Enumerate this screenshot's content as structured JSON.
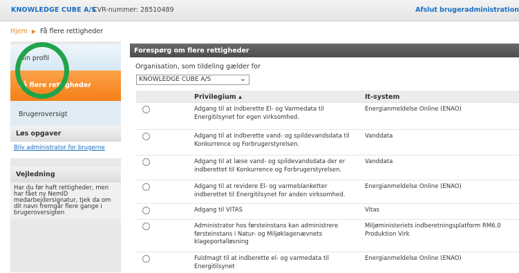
{
  "header": {
    "company": "KNOWLEDGE CUBE A/S",
    "cvr": "CVR-nummer: 28510489",
    "end_link": "Afslut brugeradministration"
  },
  "breadcrumb": {
    "home": "Hjem",
    "separator": "▶",
    "current": "Få flere rettigheder"
  },
  "sidebar": {
    "nav": [
      "Min profil",
      "Få flere rettigheder",
      "Brugeroversigt"
    ],
    "tasks_title": "Løs opgaver",
    "tasks_link": "Bliv administrator for brugerne",
    "guide_title": "Vejledning",
    "guide_text": "Har du før haft rettigheder, men har fået ny NemID medarbejdersignatur, tjek da om dit navn fremgår flere gange i brugeroversigten"
  },
  "main": {
    "panel_title": "Forespørg om flere rettigheder",
    "org_label": "Organisation, som tildeling gælder for",
    "org_selected": "KNOWLEDGE CUBE A/S",
    "col_privilege": "Privilegium ▴",
    "col_system": "It-system",
    "rows": [
      {
        "privilege": "Adgang til at indberette El- og Varmedata til Energitilsynet for egen virksomhed.",
        "system": "Energianmeldelse Online (ENAO)"
      },
      {
        "privilege": "Adgang til at indberette vand- og spildevandsdata til Konkurrence og Forbrugerstyrelsen.",
        "system": "Vanddata"
      },
      {
        "privilege": "Adgang til at læse vand- og spildevandsdata der er indberettet til Konkurrence og Forbrugerstyrelsen.",
        "system": "Vanddata"
      },
      {
        "privilege": "Adgang til at revidere El- og varmeblanketter indberettet til Energitilsynet for anden virksomhed.",
        "system": "Energianmeldelse Online (ENAO)"
      },
      {
        "privilege": "Adgang til VITAS",
        "system": "Vitas"
      },
      {
        "privilege": "Administrator hos førsteinstans kan administrere førsteinstans i Natur- og Miljøklagenævnets klageportalløsning",
        "system": "Miljøministeriets indberetningsplatform RM6.0 Produktion Virk"
      },
      {
        "privilege": "Fuldmagt til at indberette el- og varmedata til Energitilsynet",
        "system": "Energianmeldelse Online (ENAO)"
      }
    ]
  },
  "colors": {
    "accent_blue": "#1a6ec0",
    "active_orange": "#f57f17",
    "annotation_green": "#21a34a",
    "panel_header": "#555555"
  }
}
